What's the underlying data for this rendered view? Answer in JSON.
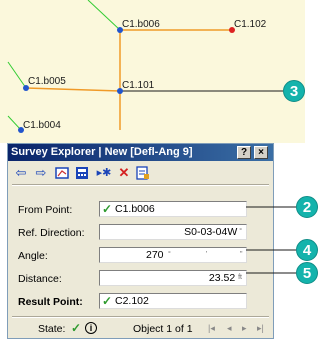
{
  "map": {
    "points": [
      {
        "label": "C1.b006",
        "color": "#2255cc"
      },
      {
        "label": "C1.102",
        "color": "#dd2222"
      },
      {
        "label": "C1.b005",
        "color": "#2255cc"
      },
      {
        "label": "C1.101",
        "color": "#2255cc"
      },
      {
        "label": "C1.b004",
        "color": "#2255cc"
      }
    ],
    "line_colors": {
      "course": "#f09a28",
      "green": "#33cc33"
    }
  },
  "callouts": [
    "2",
    "3",
    "4",
    "5"
  ],
  "window": {
    "title": "Survey Explorer | New [Defl-Ang 9]",
    "title_buttons": [
      "?",
      "×"
    ]
  },
  "toolbar": {
    "icons": [
      "back-arrow-icon",
      "forward-arrow-icon",
      "sketch-icon",
      "calculator-icon",
      "insert-icon",
      "delete-icon",
      "report-icon"
    ]
  },
  "form": {
    "from_point": {
      "label": "From Point:",
      "value": "C1.b006"
    },
    "ref_direction": {
      "label": "Ref. Direction:",
      "value": "S0-03-04W"
    },
    "angle": {
      "label": "Angle:",
      "value": "270"
    },
    "distance": {
      "label": "Distance:",
      "value": "23.52",
      "unit": "ft"
    },
    "result_point": {
      "label": "Result Point:",
      "value": "C2.102"
    }
  },
  "status": {
    "state_label": "State:",
    "object_text": "Object 1 of 1"
  }
}
